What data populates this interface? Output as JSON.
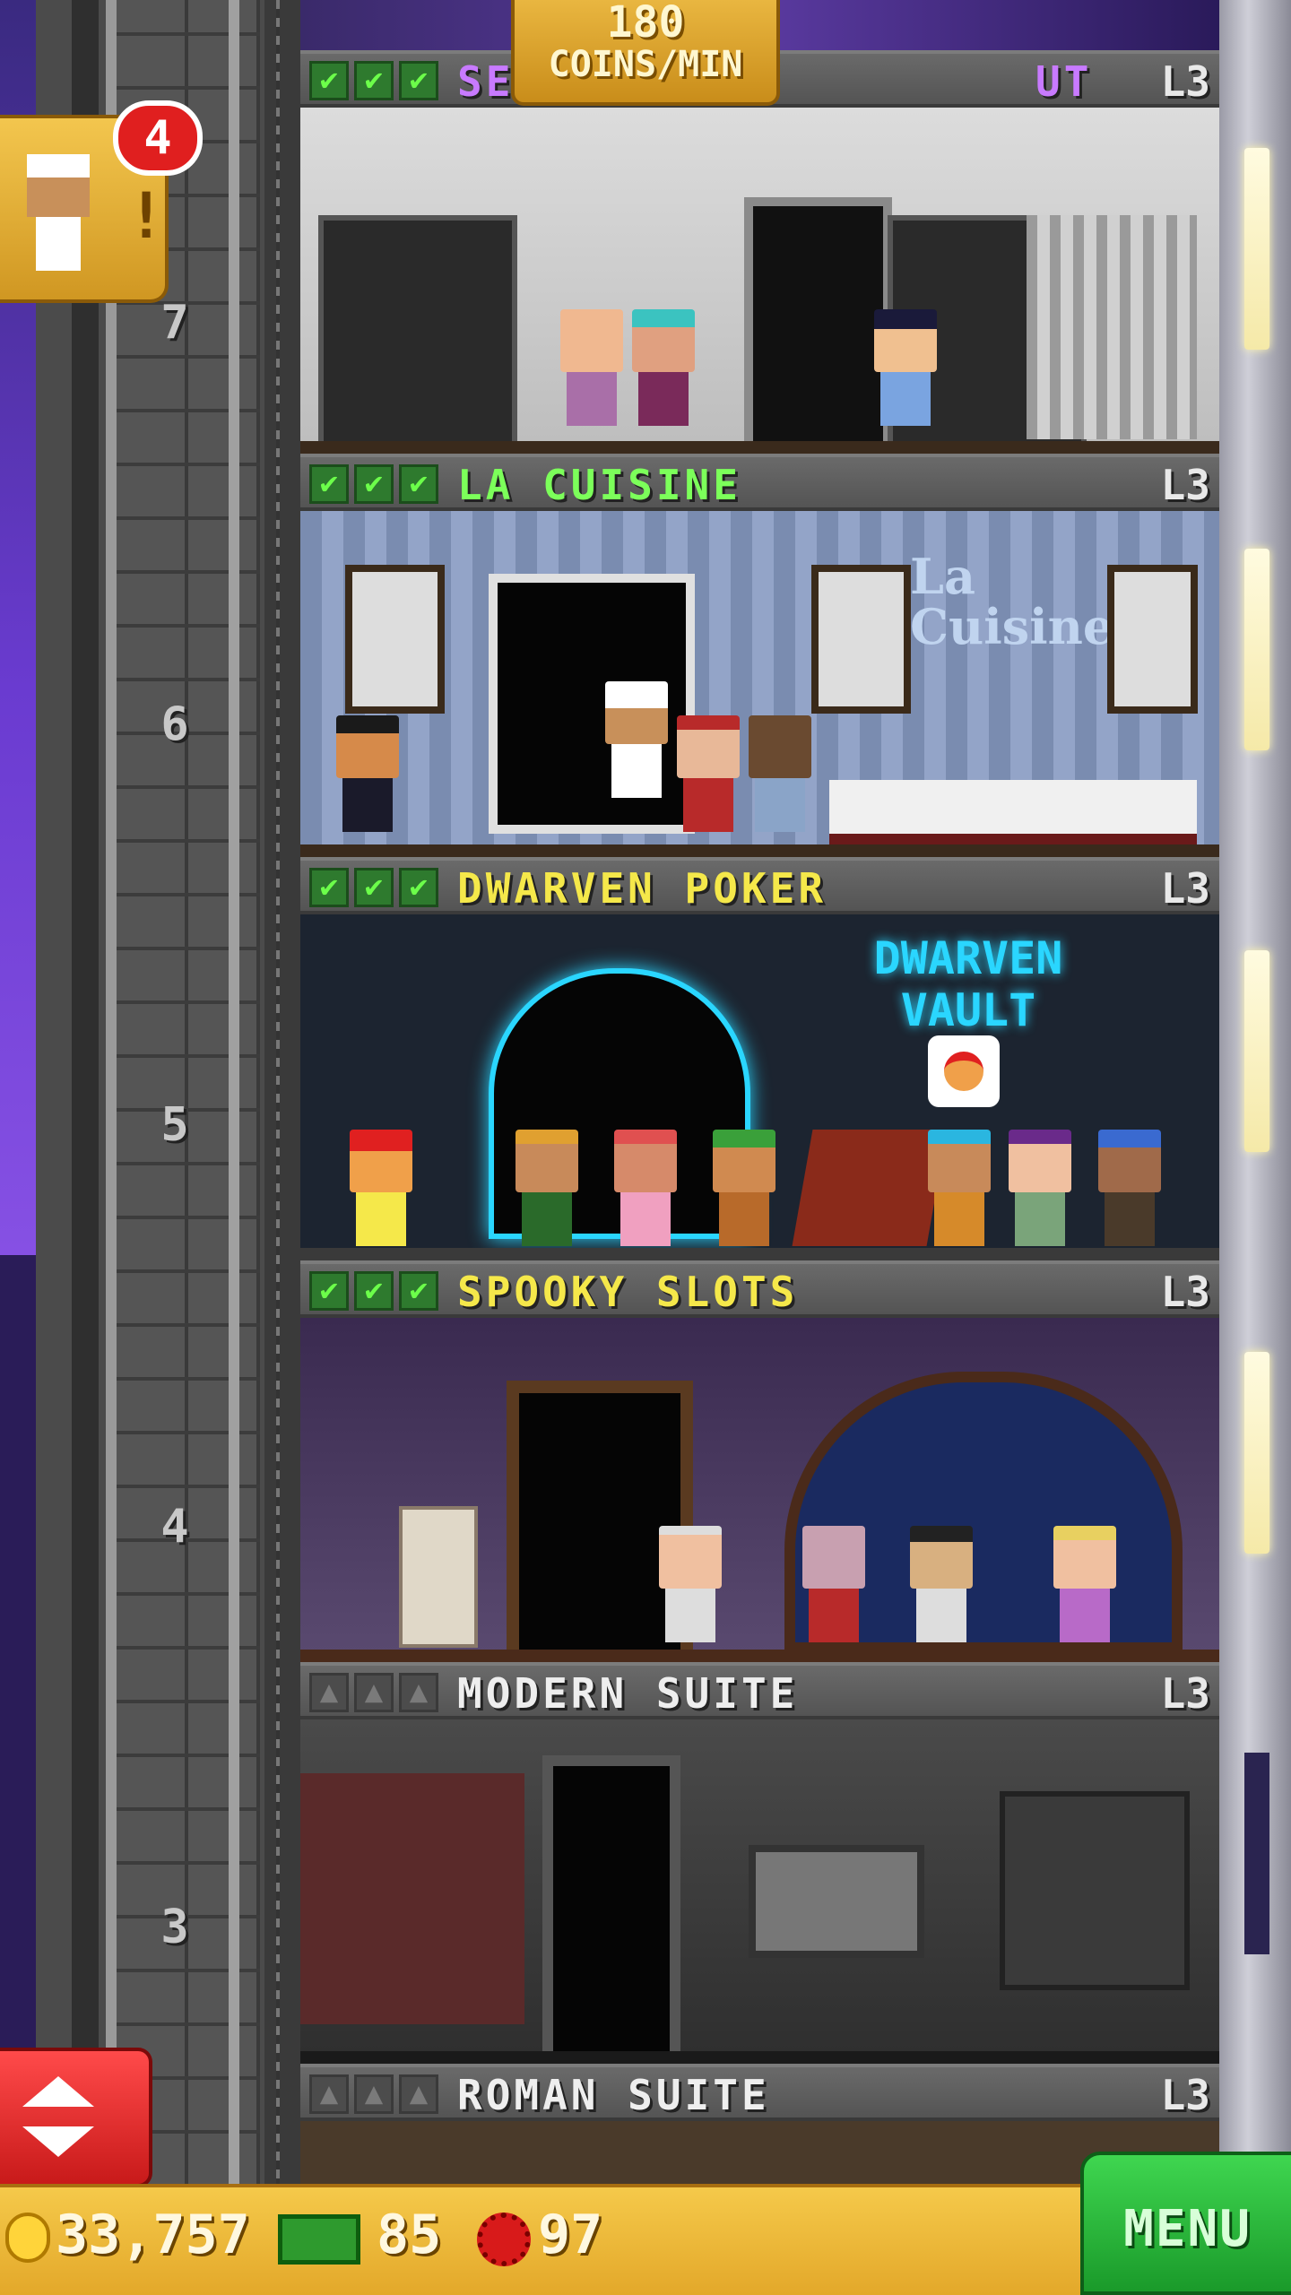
{
  "coins_per_min": {
    "value": "180",
    "unit": "COINS/MIN"
  },
  "notification": {
    "count": "4",
    "icon": "chef-icon"
  },
  "floors": [
    {
      "number": "7",
      "name": "SE",
      "name_after": "UT",
      "name_color": "#c87aff",
      "level": "L3",
      "checks": 3
    },
    {
      "number": "6",
      "name": "LA CUISINE",
      "name_color": "#7cff5a",
      "level": "L3",
      "checks": 3,
      "sign": "La Cuisine"
    },
    {
      "number": "5",
      "name": "DWARVEN POKER",
      "name_color": "#f5e84a",
      "level": "L3",
      "checks": 3,
      "sign": "DWARVEN VAULT"
    },
    {
      "number": "4",
      "name": "SPOOKY SLOTS",
      "name_color": "#f5e84a",
      "level": "L3",
      "checks": 3
    },
    {
      "number": "3",
      "name": "MODERN SUITE",
      "name_color": "#eeeeee",
      "level": "L3",
      "checks": 0
    },
    {
      "number": "",
      "name": "ROMAN SUITE",
      "name_color": "#eeeeee",
      "level": "L3",
      "checks": 0
    }
  ],
  "bottom_bar": {
    "coins": "33,757",
    "bux": "85",
    "tokens": "97",
    "menu_label": "MENU"
  },
  "colors": {
    "gold": "#e3a82a",
    "green": "#1a9a2a",
    "red": "#e01f1f"
  }
}
